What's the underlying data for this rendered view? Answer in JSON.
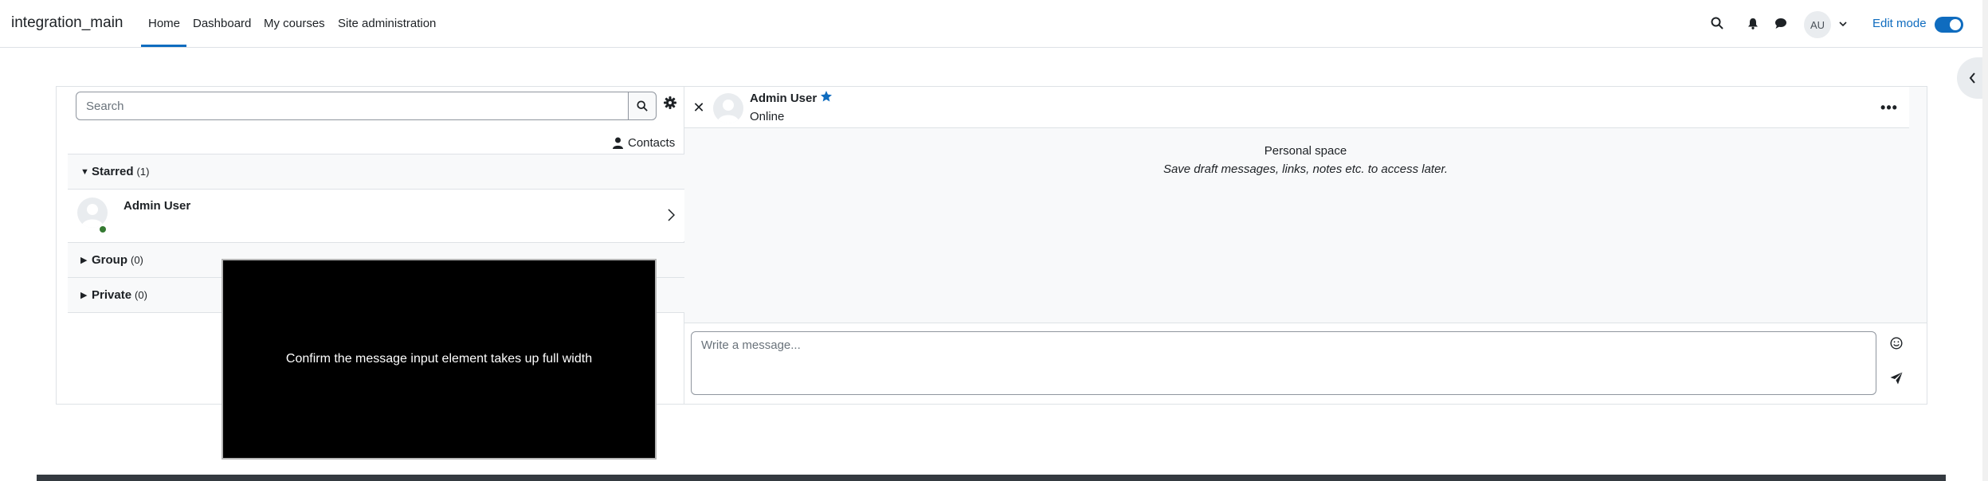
{
  "navbar": {
    "brand": "integration_main",
    "items": [
      {
        "label": "Home",
        "active": true
      },
      {
        "label": "Dashboard",
        "active": false
      },
      {
        "label": "My courses",
        "active": false
      },
      {
        "label": "Site administration",
        "active": false
      }
    ],
    "icons": [
      "search-icon",
      "bell-icon",
      "chat-icon"
    ],
    "user_initials": "AU",
    "edit_mode_label": "Edit mode",
    "edit_mode_on": true
  },
  "messaging": {
    "search": {
      "placeholder": "Search",
      "value": ""
    },
    "contacts_label": "Contacts",
    "sections": [
      {
        "title": "Starred",
        "count": "(1)",
        "expanded": true
      },
      {
        "title": "Group",
        "count": "(0)",
        "expanded": false
      },
      {
        "title": "Private",
        "count": "(0)",
        "expanded": false
      }
    ],
    "starred_contacts": [
      {
        "name": "Admin User",
        "online": true
      }
    ],
    "conversation": {
      "name": "Admin User",
      "status": "Online",
      "starred": true,
      "personal_title": "Personal space",
      "personal_subtitle": "Save draft messages, links, notes etc. to access later.",
      "composer_placeholder": "Write a message..."
    }
  },
  "overlay": {
    "text": "Confirm the message input element takes up full width"
  },
  "colors": {
    "accent": "#0f6cbf",
    "online": "#357a32",
    "star": "#0f6cbf"
  }
}
